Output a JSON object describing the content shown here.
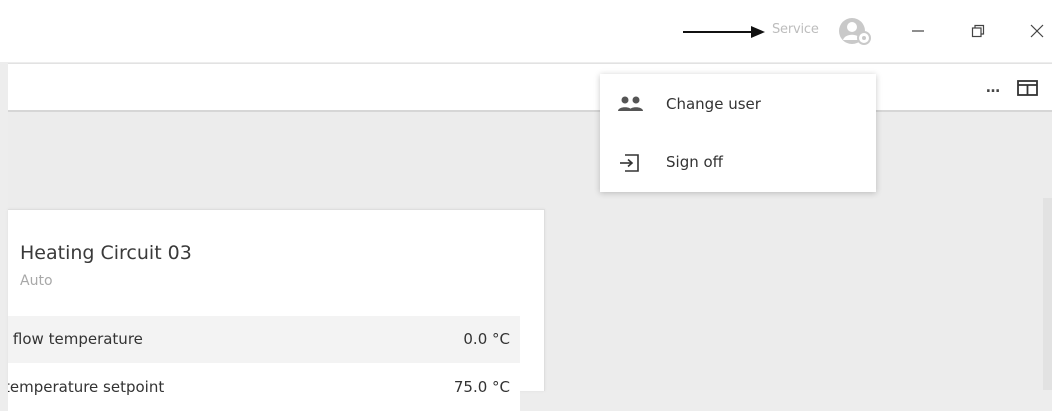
{
  "titlebar": {
    "user_label": "Service",
    "arrow_icon": "right-arrow-icon",
    "user_icon": "user-settings-icon",
    "minimize_icon": "minimize-icon",
    "restore_icon": "restore-icon",
    "close_icon": "close-icon"
  },
  "toolbar": {
    "more_icon": "more-options-icon",
    "more_glyph": "…",
    "pane_icon": "split-pane-icon"
  },
  "menu": {
    "items": [
      {
        "label": "Change user",
        "icon": "users-icon"
      },
      {
        "label": "Sign off",
        "icon": "sign-off-icon"
      }
    ]
  },
  "card": {
    "title": "Heating Circuit 03",
    "subtitle": "Auto",
    "rows": [
      {
        "label": "l flow temperature",
        "value": "0.0 °C"
      },
      {
        "label": "temperature setpoint",
        "value": "75.0 °C"
      }
    ]
  },
  "colors": {
    "background": "#ededed",
    "surface": "#ffffff",
    "muted_text": "#bdbdbd",
    "text": "#333333"
  }
}
